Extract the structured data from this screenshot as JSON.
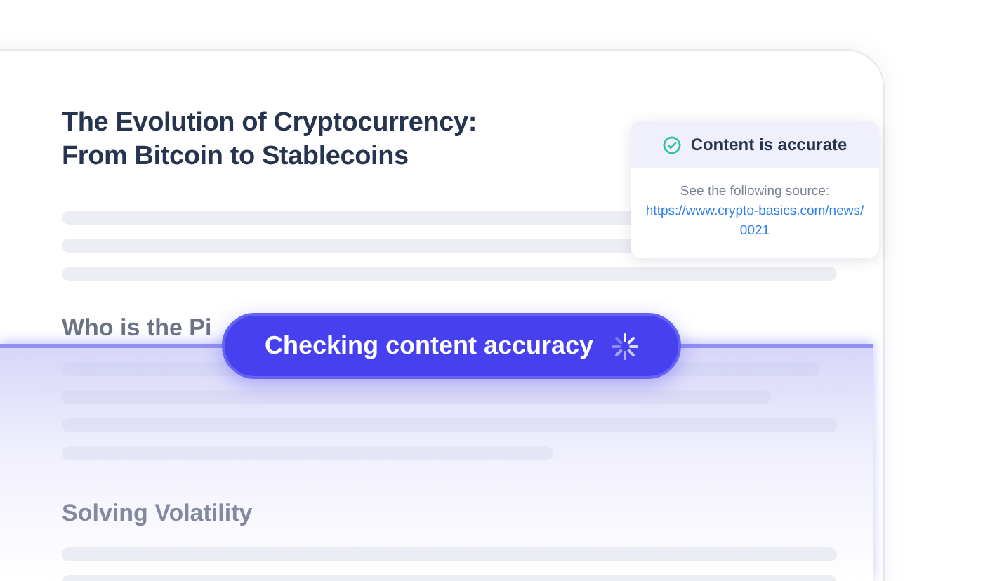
{
  "article": {
    "title": "The Evolution of Cryptocurrency:\nFrom Bitcoin to Stablecoins",
    "sections": [
      {
        "heading": "Who is the Pi"
      },
      {
        "heading": "Solving Volatility"
      }
    ]
  },
  "scan_status": {
    "label": "Checking content accuracy"
  },
  "result_popup": {
    "title": "Content is accurate",
    "source_label": "See the following source:",
    "source_link": "https://www.crypto-basics.com/news/0021"
  }
}
